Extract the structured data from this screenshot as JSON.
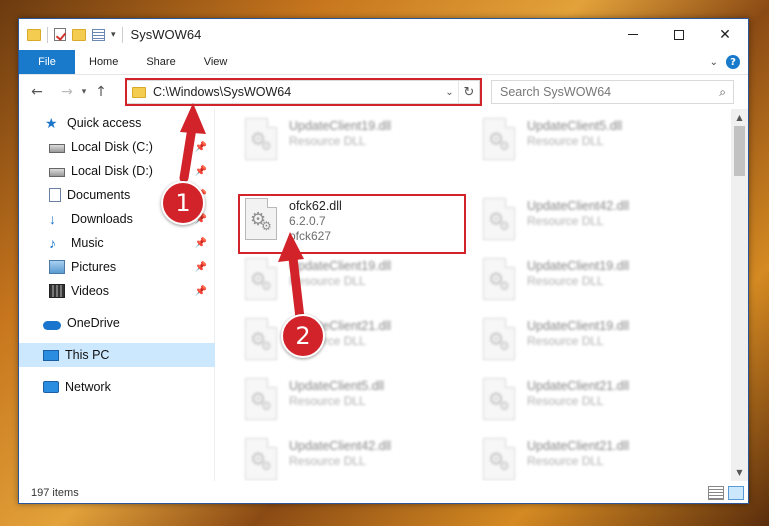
{
  "window": {
    "title": "SysWOW64",
    "controls": {
      "minimize": "—",
      "maximize": "☐",
      "close": "✕"
    }
  },
  "ribbon": {
    "tabs": [
      "File",
      "Home",
      "Share",
      "View"
    ],
    "help": "?"
  },
  "address_bar": {
    "path": "C:\\Windows\\SysWOW64",
    "search_placeholder": "Search SysWOW64"
  },
  "sidebar": {
    "items": [
      {
        "label": "Quick access",
        "icon": "star-icon",
        "pinned": false
      },
      {
        "label": "Local Disk (C:)",
        "icon": "disk-icon",
        "pinned": true
      },
      {
        "label": "Local Disk (D:)",
        "icon": "disk-icon",
        "pinned": true
      },
      {
        "label": "Documents",
        "icon": "documents-icon",
        "pinned": true
      },
      {
        "label": "Downloads",
        "icon": "downloads-icon",
        "pinned": true
      },
      {
        "label": "Music",
        "icon": "music-icon",
        "pinned": true
      },
      {
        "label": "Pictures",
        "icon": "pictures-icon",
        "pinned": true
      },
      {
        "label": "Videos",
        "icon": "videos-icon",
        "pinned": true
      },
      {
        "label": "OneDrive",
        "icon": "onedrive-icon",
        "pinned": false
      },
      {
        "label": "This PC",
        "icon": "this-pc-icon",
        "pinned": false,
        "selected": true
      },
      {
        "label": "Network",
        "icon": "network-icon",
        "pinned": false
      }
    ]
  },
  "files": [
    {
      "name": "UpdateClient19.dll",
      "line2": "Resource DLL",
      "line3": "",
      "blurred": true
    },
    {
      "name": "UpdateClient5.dll",
      "line2": "Resource DLL",
      "line3": "",
      "blurred": true
    },
    {
      "name": "ofck62.dll",
      "line2": "6.2.0.7",
      "line3": "ofck627",
      "blurred": false
    },
    {
      "name": "UpdateClient42.dll",
      "line2": "Resource DLL",
      "line3": "",
      "blurred": true
    },
    {
      "name": "UpdateClient19.dll",
      "line2": "Resource DLL",
      "line3": "",
      "blurred": true
    },
    {
      "name": "UpdateClient19.dll",
      "line2": "Resource DLL",
      "line3": "",
      "blurred": true
    },
    {
      "name": "UpdateClient21.dll",
      "line2": "Resource DLL",
      "line3": "",
      "blurred": true
    },
    {
      "name": "UpdateClient19.dll",
      "line2": "Resource DLL",
      "line3": "",
      "blurred": true
    },
    {
      "name": "UpdateClient5.dll",
      "line2": "Resource DLL",
      "line3": "",
      "blurred": true
    },
    {
      "name": "UpdateClient21.dll",
      "line2": "Resource DLL",
      "line3": "",
      "blurred": true
    },
    {
      "name": "UpdateClient42.dll",
      "line2": "Resource DLL",
      "line3": "",
      "blurred": true
    },
    {
      "name": "UpdateClient21.dll",
      "line2": "Resource DLL",
      "line3": "",
      "blurred": true
    }
  ],
  "status": {
    "item_count": "197 items"
  },
  "callouts": [
    {
      "number": "1",
      "target": "address bar"
    },
    {
      "number": "2",
      "target": "ofck62.dll"
    }
  ],
  "colors": {
    "accent": "#1979ca",
    "highlight": "#d2232a",
    "selected": "#cce8ff"
  }
}
